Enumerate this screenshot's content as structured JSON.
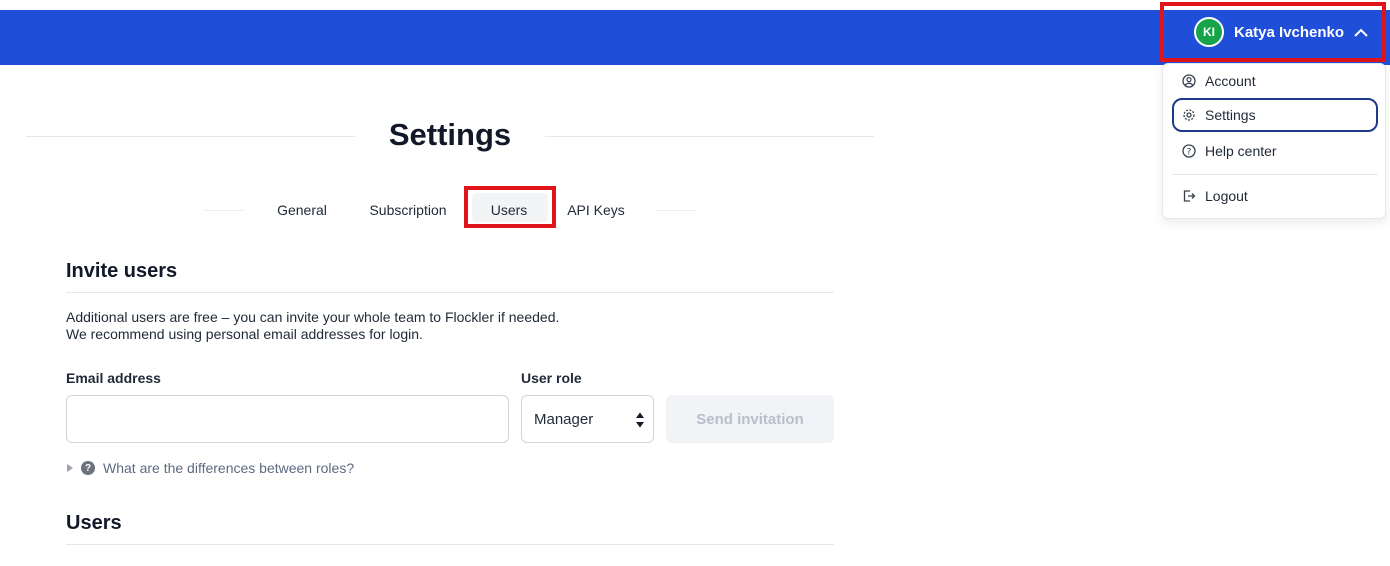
{
  "header": {
    "user": {
      "initials": "KI",
      "name": "Katya Ivchenko"
    }
  },
  "user_menu": {
    "items": [
      {
        "label": "Account",
        "icon": "user-circle-icon"
      },
      {
        "label": "Settings",
        "icon": "gear-icon",
        "active": true
      },
      {
        "label": "Help center",
        "icon": "question-circle-icon"
      },
      {
        "label": "Logout",
        "icon": "logout-icon"
      }
    ]
  },
  "page": {
    "title": "Settings"
  },
  "tabs": [
    {
      "label": "General"
    },
    {
      "label": "Subscription"
    },
    {
      "label": "Users",
      "active": true
    },
    {
      "label": "API Keys"
    }
  ],
  "invite": {
    "title": "Invite users",
    "description_line1": "Additional users are free – you can invite your whole team to Flockler if needed.",
    "description_line2": "We recommend using personal email addresses for login.",
    "email_label": "Email address",
    "email_value": "",
    "role_label": "User role",
    "role_value": "Manager",
    "send_label": "Send invitation",
    "roles_help": "What are the differences between roles?"
  },
  "users_section": {
    "title": "Users"
  },
  "colors": {
    "topbar": "#1f4fd8",
    "avatar": "#16a34a",
    "highlight": "#e0141b",
    "active_outline": "#1e3a8a"
  }
}
